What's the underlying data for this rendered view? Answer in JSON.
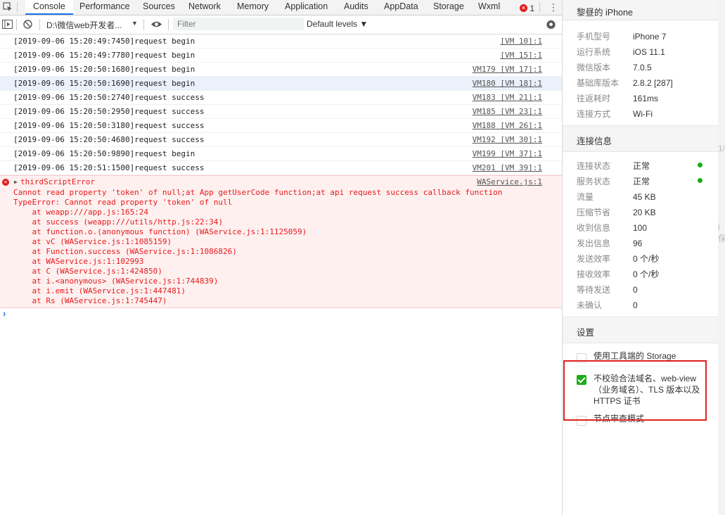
{
  "tabs": [
    "Console",
    "Performance",
    "Sources",
    "Network",
    "Memory",
    "Application",
    "Audits",
    "AppData",
    "Storage",
    "Wxml"
  ],
  "error_badge": "1",
  "toolbar": {
    "context": "D:\\微信web开发者...",
    "filter_placeholder": "Filter",
    "levels": "Default levels ▼"
  },
  "logs": [
    {
      "msg": "[2019-09-06 15:20:49:7450]request begin",
      "src": "[VM 10]:1"
    },
    {
      "msg": "[2019-09-06 15:20:49:7780]request begin",
      "src": "[VM 15]:1"
    },
    {
      "msg": "[2019-09-06 15:20:50:1680]request begin",
      "src": "VM179 [VM 17]:1"
    },
    {
      "msg": "[2019-09-06 15:20:50:1690]request begin",
      "src": "VM180 [VM 18]:1"
    },
    {
      "msg": "[2019-09-06 15:20:50:2740]request success",
      "src": "VM183 [VM 21]:1"
    },
    {
      "msg": "[2019-09-06 15:20:50:2950]request success",
      "src": "VM185 [VM 23]:1"
    },
    {
      "msg": "[2019-09-06 15:20:50:3180]request success",
      "src": "VM188 [VM 26]:1"
    },
    {
      "msg": "[2019-09-06 15:20:50:4680]request success",
      "src": "VM192 [VM 30]:1"
    },
    {
      "msg": "[2019-09-06 15:20:50:9890]request begin",
      "src": "VM199 [VM 37]:1"
    },
    {
      "msg": "[2019-09-06 15:20:51:1500]request success",
      "src": "VM201 [VM 39]:1"
    }
  ],
  "error": {
    "title": "thirdScriptError",
    "src": "WAService.js:1",
    "lines": [
      "Cannot read property 'token' of null;at App getUserCode function;at api request success callback function",
      "TypeError: Cannot read property 'token' of null",
      "    at weapp:///app.js:165:24",
      "    at success (weapp:///utils/http.js:22:34)",
      "    at function.o.(anonymous function) (WAService.js:1:1125059)",
      "    at vC (WAService.js:1:1085159)",
      "    at Function.success (WAService.js:1:1086826)",
      "    at WAService.js:1:102993",
      "    at C (WAService.js:1:424850)",
      "    at i.<anonymous> (WAService.js:1:744839)",
      "    at i.emit (WAService.js:1:447481)",
      "    at Rs (WAService.js:1:745447)"
    ]
  },
  "prompt": "›",
  "panel": {
    "device_title": "黎昼的 iPhone",
    "device_info": [
      {
        "k": "手机型号",
        "v": "iPhone 7"
      },
      {
        "k": "运行系统",
        "v": "iOS 11.1"
      },
      {
        "k": "微信版本",
        "v": "7.0.5"
      },
      {
        "k": "基础库版本",
        "v": "2.8.2 [287]"
      },
      {
        "k": "往返耗时",
        "v": "161ms"
      },
      {
        "k": "连接方式",
        "v": "Wi-Fi"
      }
    ],
    "conn_title": "连接信息",
    "conn_info": [
      {
        "k": "连接状态",
        "v": "正常"
      },
      {
        "k": "服务状态",
        "v": "正常"
      },
      {
        "k": "流量",
        "v": "45 KB"
      },
      {
        "k": "压缩节省",
        "v": "20 KB"
      },
      {
        "k": "收到信息",
        "v": "100"
      },
      {
        "k": "发出信息",
        "v": "96"
      },
      {
        "k": "发送效率",
        "v": "0 个/秒"
      },
      {
        "k": "接收效率",
        "v": "0 个/秒"
      },
      {
        "k": "等待发送",
        "v": "0"
      },
      {
        "k": "未确认",
        "v": "0"
      }
    ],
    "settings_title": "设置",
    "options": [
      {
        "label": "使用工具端的 Storage",
        "checked": false
      },
      {
        "label": "不校验合法域名、web-view（业务域名）、TLS 版本以及 HTTPS 证书",
        "checked": true
      },
      {
        "label": "节点审查模式",
        "checked": false
      }
    ]
  },
  "strip": {
    "a": "1/",
    "b": "i保"
  },
  "colors": {
    "accent": "#1a73e8",
    "error": "#e41b1b",
    "ok": "#1aad19",
    "highlight": "#e02020"
  }
}
